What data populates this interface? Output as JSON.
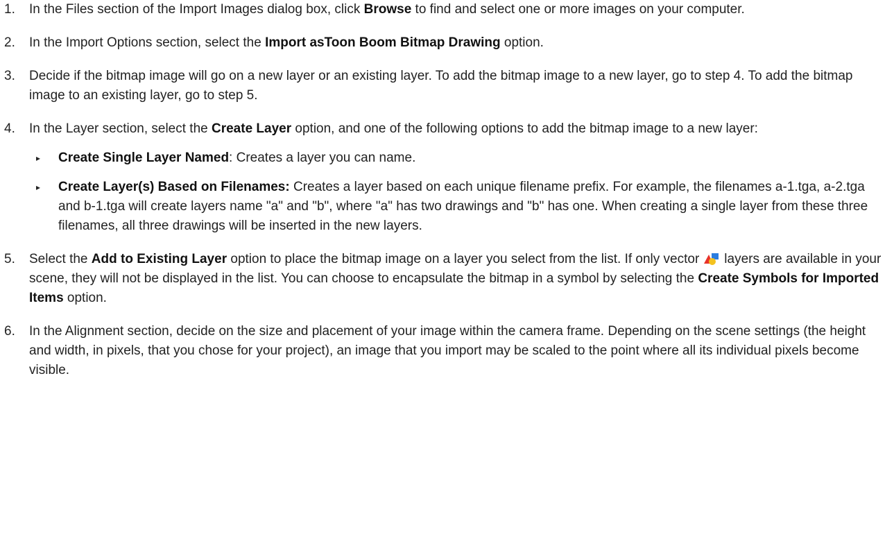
{
  "steps": [
    {
      "num": "1.",
      "parts": [
        {
          "t": "In the Files section of the Import Images dialog box, click "
        },
        {
          "t": "Browse",
          "b": true
        },
        {
          "t": " to find and select one or more images on your computer."
        }
      ]
    },
    {
      "num": "2.",
      "parts": [
        {
          "t": "In the Import Options section, select the "
        },
        {
          "t": "Import asToon Boom Bitmap Drawing",
          "b": true
        },
        {
          "t": " option."
        }
      ]
    },
    {
      "num": "3.",
      "parts": [
        {
          "t": "Decide if the bitmap image will go on a new layer or an existing layer. To add the bitmap image to a new layer, go to step 4. To add the bitmap image to an existing layer, go to step 5."
        }
      ]
    },
    {
      "num": "4.",
      "parts": [
        {
          "t": "In the Layer section, select the "
        },
        {
          "t": "Create Layer",
          "b": true
        },
        {
          "t": " option, and one of the following options to add the bitmap image to a new layer:"
        }
      ],
      "bullets": [
        [
          {
            "t": "Create Single Layer Named",
            "b": true
          },
          {
            "t": ": Creates a layer you can name."
          }
        ],
        [
          {
            "t": "Create Layer(s) Based on Filenames:",
            "b": true
          },
          {
            "t": " Creates a layer based on each unique filename prefix. For example, the filenames a-1.tga, a-2.tga and b-1.tga will create layers name \"a\" and \"b\", where \"a\" has two drawings and \"b\" has one. When creating a single layer from these three filenames, all three drawings will be inserted in the new layers."
          }
        ]
      ]
    },
    {
      "num": "5.",
      "parts": [
        {
          "t": "Select the "
        },
        {
          "t": "Add to Existing Layer",
          "b": true
        },
        {
          "t": " option to place the bitmap image on a layer you select from the list. If only vector"
        },
        {
          "icon": "vector-layer-icon"
        },
        {
          "t": "layers are available in your scene, they will not be displayed in the list. You can choose to encap­sulate the bitmap in a symbol by selecting the "
        },
        {
          "t": "Create Symbols for Imported Items",
          "b": true
        },
        {
          "t": " option."
        }
      ]
    },
    {
      "num": "6.",
      "parts": [
        {
          "t": "In the Alignment section, decide on the size and placement of your image within the camera frame. Depend­ing on the scene settings (the height and width, in pixels, that you chose for your project), an image that you import may be scaled to the point where all its individual pixels become visible."
        }
      ]
    }
  ],
  "bullet_glyph": "▸",
  "icons": {
    "vector-layer-icon": {
      "colors": [
        "#e8332a",
        "#2b7de0",
        "#f4c21f"
      ]
    }
  }
}
